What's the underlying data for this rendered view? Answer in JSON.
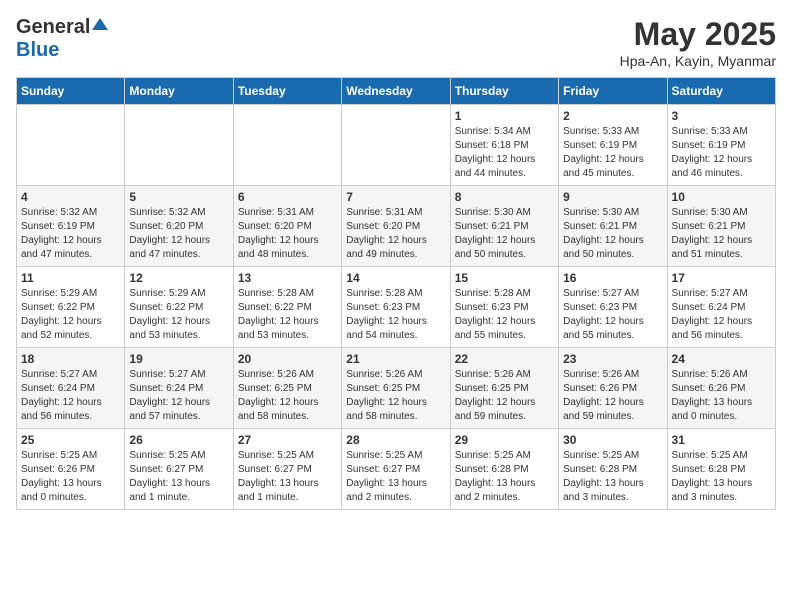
{
  "header": {
    "logo_general": "General",
    "logo_blue": "Blue",
    "month_title": "May 2025",
    "location": "Hpa-An, Kayin, Myanmar"
  },
  "weekdays": [
    "Sunday",
    "Monday",
    "Tuesday",
    "Wednesday",
    "Thursday",
    "Friday",
    "Saturday"
  ],
  "weeks": [
    [
      {
        "day": "",
        "info": ""
      },
      {
        "day": "",
        "info": ""
      },
      {
        "day": "",
        "info": ""
      },
      {
        "day": "",
        "info": ""
      },
      {
        "day": "1",
        "info": "Sunrise: 5:34 AM\nSunset: 6:18 PM\nDaylight: 12 hours\nand 44 minutes."
      },
      {
        "day": "2",
        "info": "Sunrise: 5:33 AM\nSunset: 6:19 PM\nDaylight: 12 hours\nand 45 minutes."
      },
      {
        "day": "3",
        "info": "Sunrise: 5:33 AM\nSunset: 6:19 PM\nDaylight: 12 hours\nand 46 minutes."
      }
    ],
    [
      {
        "day": "4",
        "info": "Sunrise: 5:32 AM\nSunset: 6:19 PM\nDaylight: 12 hours\nand 47 minutes."
      },
      {
        "day": "5",
        "info": "Sunrise: 5:32 AM\nSunset: 6:20 PM\nDaylight: 12 hours\nand 47 minutes."
      },
      {
        "day": "6",
        "info": "Sunrise: 5:31 AM\nSunset: 6:20 PM\nDaylight: 12 hours\nand 48 minutes."
      },
      {
        "day": "7",
        "info": "Sunrise: 5:31 AM\nSunset: 6:20 PM\nDaylight: 12 hours\nand 49 minutes."
      },
      {
        "day": "8",
        "info": "Sunrise: 5:30 AM\nSunset: 6:21 PM\nDaylight: 12 hours\nand 50 minutes."
      },
      {
        "day": "9",
        "info": "Sunrise: 5:30 AM\nSunset: 6:21 PM\nDaylight: 12 hours\nand 50 minutes."
      },
      {
        "day": "10",
        "info": "Sunrise: 5:30 AM\nSunset: 6:21 PM\nDaylight: 12 hours\nand 51 minutes."
      }
    ],
    [
      {
        "day": "11",
        "info": "Sunrise: 5:29 AM\nSunset: 6:22 PM\nDaylight: 12 hours\nand 52 minutes."
      },
      {
        "day": "12",
        "info": "Sunrise: 5:29 AM\nSunset: 6:22 PM\nDaylight: 12 hours\nand 53 minutes."
      },
      {
        "day": "13",
        "info": "Sunrise: 5:28 AM\nSunset: 6:22 PM\nDaylight: 12 hours\nand 53 minutes."
      },
      {
        "day": "14",
        "info": "Sunrise: 5:28 AM\nSunset: 6:23 PM\nDaylight: 12 hours\nand 54 minutes."
      },
      {
        "day": "15",
        "info": "Sunrise: 5:28 AM\nSunset: 6:23 PM\nDaylight: 12 hours\nand 55 minutes."
      },
      {
        "day": "16",
        "info": "Sunrise: 5:27 AM\nSunset: 6:23 PM\nDaylight: 12 hours\nand 55 minutes."
      },
      {
        "day": "17",
        "info": "Sunrise: 5:27 AM\nSunset: 6:24 PM\nDaylight: 12 hours\nand 56 minutes."
      }
    ],
    [
      {
        "day": "18",
        "info": "Sunrise: 5:27 AM\nSunset: 6:24 PM\nDaylight: 12 hours\nand 56 minutes."
      },
      {
        "day": "19",
        "info": "Sunrise: 5:27 AM\nSunset: 6:24 PM\nDaylight: 12 hours\nand 57 minutes."
      },
      {
        "day": "20",
        "info": "Sunrise: 5:26 AM\nSunset: 6:25 PM\nDaylight: 12 hours\nand 58 minutes."
      },
      {
        "day": "21",
        "info": "Sunrise: 5:26 AM\nSunset: 6:25 PM\nDaylight: 12 hours\nand 58 minutes."
      },
      {
        "day": "22",
        "info": "Sunrise: 5:26 AM\nSunset: 6:25 PM\nDaylight: 12 hours\nand 59 minutes."
      },
      {
        "day": "23",
        "info": "Sunrise: 5:26 AM\nSunset: 6:26 PM\nDaylight: 12 hours\nand 59 minutes."
      },
      {
        "day": "24",
        "info": "Sunrise: 5:26 AM\nSunset: 6:26 PM\nDaylight: 13 hours\nand 0 minutes."
      }
    ],
    [
      {
        "day": "25",
        "info": "Sunrise: 5:25 AM\nSunset: 6:26 PM\nDaylight: 13 hours\nand 0 minutes."
      },
      {
        "day": "26",
        "info": "Sunrise: 5:25 AM\nSunset: 6:27 PM\nDaylight: 13 hours\nand 1 minute."
      },
      {
        "day": "27",
        "info": "Sunrise: 5:25 AM\nSunset: 6:27 PM\nDaylight: 13 hours\nand 1 minute."
      },
      {
        "day": "28",
        "info": "Sunrise: 5:25 AM\nSunset: 6:27 PM\nDaylight: 13 hours\nand 2 minutes."
      },
      {
        "day": "29",
        "info": "Sunrise: 5:25 AM\nSunset: 6:28 PM\nDaylight: 13 hours\nand 2 minutes."
      },
      {
        "day": "30",
        "info": "Sunrise: 5:25 AM\nSunset: 6:28 PM\nDaylight: 13 hours\nand 3 minutes."
      },
      {
        "day": "31",
        "info": "Sunrise: 5:25 AM\nSunset: 6:28 PM\nDaylight: 13 hours\nand 3 minutes."
      }
    ]
  ]
}
